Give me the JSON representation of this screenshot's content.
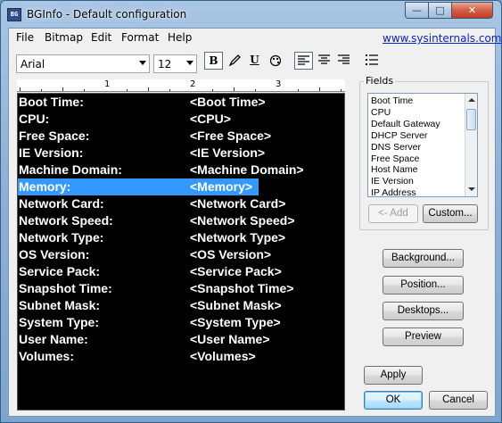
{
  "window": {
    "title": "BGInfo - Default configuration",
    "icon_text": "BG",
    "controls": {
      "minimize": "—",
      "maximize": "□",
      "close": "✕"
    }
  },
  "menu": {
    "items": [
      "File",
      "Bitmap",
      "Edit",
      "Format",
      "Help"
    ],
    "link": "www.sysinternals.com"
  },
  "toolbar": {
    "font": "Arial",
    "size": "12",
    "bold": "B",
    "underline": "U"
  },
  "ruler": {
    "labels": [
      "1",
      "2",
      "3"
    ]
  },
  "editor": {
    "rows": [
      {
        "label": "Boot Time:",
        "field": "<Boot Time>"
      },
      {
        "label": "CPU:",
        "field": "<CPU>"
      },
      {
        "label": "Free Space:",
        "field": "<Free Space>"
      },
      {
        "label": "IE Version:",
        "field": "<IE Version>"
      },
      {
        "label": "Machine Domain:",
        "field": "<Machine Domain>"
      },
      {
        "label": "Memory:",
        "field": "<Memory>",
        "selected": true
      },
      {
        "label": "Network Card:",
        "field": "<Network Card>"
      },
      {
        "label": "Network Speed:",
        "field": "<Network Speed>"
      },
      {
        "label": "Network Type:",
        "field": "<Network Type>"
      },
      {
        "label": "OS Version:",
        "field": "<OS Version>"
      },
      {
        "label": "Service Pack:",
        "field": "<Service Pack>"
      },
      {
        "label": "Snapshot Time:",
        "field": "<Snapshot Time>"
      },
      {
        "label": "Subnet Mask:",
        "field": "<Subnet Mask>"
      },
      {
        "label": "System Type:",
        "field": "<System Type>"
      },
      {
        "label": "User Name:",
        "field": "<User Name>"
      },
      {
        "label": "Volumes:",
        "field": "<Volumes>"
      }
    ],
    "text_color": "#ffffff",
    "background": "#000000",
    "selection_color": "#3399ff"
  },
  "fields": {
    "legend": "Fields",
    "items": [
      "Boot Time",
      "CPU",
      "Default Gateway",
      "DHCP Server",
      "DNS Server",
      "Free Space",
      "Host Name",
      "IE Version",
      "IP Address"
    ],
    "add_label": "<- Add",
    "custom_label": "Custom..."
  },
  "buttons": {
    "background": "Background...",
    "position": "Position...",
    "desktops": "Desktops...",
    "preview": "Preview",
    "apply": "Apply",
    "ok": "OK",
    "cancel": "Cancel"
  }
}
